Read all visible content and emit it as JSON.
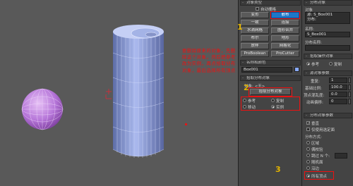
{
  "viewport": {
    "annotation": "要删除原来的对象，先删除这个对象，然后把参考改为实例，再点拾取分布对象，最后选择所有顶点",
    "colors": {
      "background": "#595959",
      "sphere": "#b676d9",
      "cylinder": "#8ea0d8"
    }
  },
  "mid_panel": {
    "header_top": "对象类型",
    "checkbox_autogrid": "自动栅格",
    "buttons": [
      "变形",
      "散布",
      "一致",
      "连接",
      "水滴网格",
      "图形合并",
      "布尔",
      "地形",
      "放样",
      "网格化",
      "ProBoolean",
      "ProCutter"
    ],
    "header_name_color": "名称和颜色",
    "name_value": "Box001",
    "header_pick": "拾取分布对象",
    "object_label": "对象: <无>",
    "pick_button": "拾取分布对象",
    "radio_reference": "参考",
    "radio_copy": "复制",
    "radio_move": "移动",
    "radio_instance": "实例",
    "marker_1": "1",
    "marker_2": "2",
    "marker_3": "3"
  },
  "right_panel": {
    "header_scatter": "分布对象",
    "object_label": "对象",
    "list_item_1": "源: S_Box001",
    "list_item_2": "分布:",
    "name_label": "名称:",
    "name_value": "S_Box001",
    "dist_name_label": "分布名称:",
    "header_pick": "拾取操作对象",
    "radio_ref": "参考",
    "radio_copy": "复制",
    "header_source": "源对象参数",
    "label_count": "重复:",
    "count_value": "1",
    "label_scale": "基础比例:",
    "scale_value": "100.0",
    "label_vertex": "顶点混乱度:",
    "vertex_value": "0.0",
    "label_anim": "动画偏移:",
    "anim_value": "0",
    "header_dist": "分布对象参数",
    "cb_perp": "垂直",
    "cb_selected": "仅使用选定面",
    "dist_method": "分布方式:",
    "opt_area": "区域",
    "opt_even": "偶校验",
    "opt_skip": "跳过 N 个:",
    "opt_random": "随机面",
    "opt_edges": "沿边",
    "opt_all_vertices": "所有顶点"
  }
}
